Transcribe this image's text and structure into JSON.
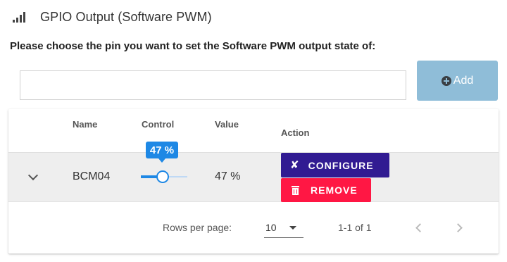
{
  "header": {
    "title": "GPIO Output (Software PWM)",
    "icon": "signal-bars-icon"
  },
  "prompt": "Please choose the pin you want to set the Software PWM output state of:",
  "pin_input": {
    "value": "",
    "placeholder": ""
  },
  "add_button": {
    "label": "Add",
    "icon": "plus-circle-icon",
    "color": "#8fbdd8"
  },
  "table": {
    "columns": {
      "name": "Name",
      "control": "Control",
      "value": "Value",
      "action": "Action"
    },
    "rows": [
      {
        "name": "BCM04",
        "control_percent": 47,
        "control_tooltip": "47 %",
        "value": "47 %",
        "actions": {
          "configure": "CONFIGURE",
          "remove": "REMOVE"
        }
      }
    ],
    "footer": {
      "rows_per_page_label": "Rows per page:",
      "rows_per_page": "10",
      "range": "1-1 of 1"
    }
  },
  "colors": {
    "accent": "#1e88e5",
    "configure": "#311b92",
    "remove": "#ff1744"
  }
}
